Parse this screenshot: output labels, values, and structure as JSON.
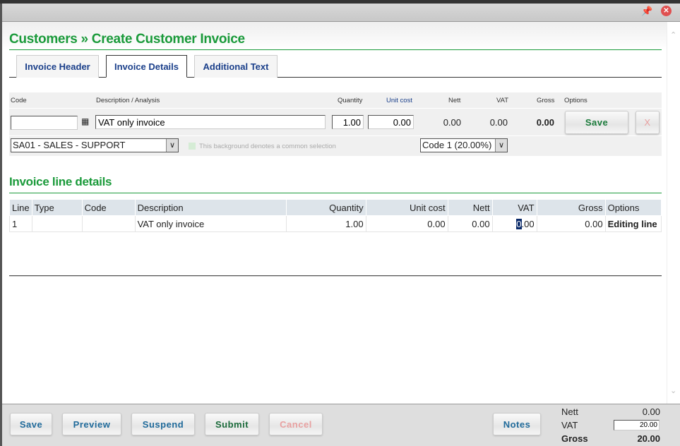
{
  "window": {
    "pin_icon": "pin-icon",
    "close_icon": "close-icon"
  },
  "page_title": "Customers » Create Customer Invoice",
  "tabs": [
    {
      "label": "Invoice Header"
    },
    {
      "label": "Invoice Details",
      "active": true
    },
    {
      "label": "Additional Text"
    }
  ],
  "entry": {
    "labels": {
      "code": "Code",
      "description": "Description / Analysis",
      "quantity": "Quantity",
      "unit_cost": "Unit cost",
      "nett": "Nett",
      "vat": "VAT",
      "gross": "Gross",
      "options": "Options"
    },
    "code": "",
    "description": "VAT only invoice",
    "quantity": "1.00",
    "unit_cost": "0.00",
    "nett": "0.00",
    "vat": "0.00",
    "gross": "0.00",
    "save_label": "Save",
    "delete_label": "X",
    "analysis": "SA01 - SALES - SUPPORT",
    "common_hint": "This background denotes a common selection",
    "vat_code": "Code 1 (20.00%)"
  },
  "lines": {
    "title": "Invoice line details",
    "columns": [
      "Line",
      "Type",
      "Code",
      "Description",
      "Quantity",
      "Unit cost",
      "Nett",
      "VAT",
      "Gross",
      "Options"
    ],
    "rows": [
      {
        "line": "1",
        "type": "",
        "code": "",
        "description": "VAT only invoice",
        "quantity": "1.00",
        "unit_cost": "0.00",
        "nett": "0.00",
        "vat_sel": "0",
        "vat_rest": ".00",
        "gross": "0.00",
        "options": "Editing line"
      }
    ]
  },
  "footer": {
    "save": "Save",
    "preview": "Preview",
    "suspend": "Suspend",
    "submit": "Submit",
    "cancel": "Cancel",
    "notes": "Notes",
    "totals": {
      "nett_label": "Nett",
      "nett": "0.00",
      "vat_label": "VAT",
      "vat": "20.00",
      "gross_label": "Gross",
      "gross": "20.00"
    }
  },
  "colors": {
    "accent_green": "#1a9a3a",
    "link_blue": "#1a3f8a",
    "button_blue": "#1f6a9a",
    "cancel_pink": "#e8a0a0"
  }
}
